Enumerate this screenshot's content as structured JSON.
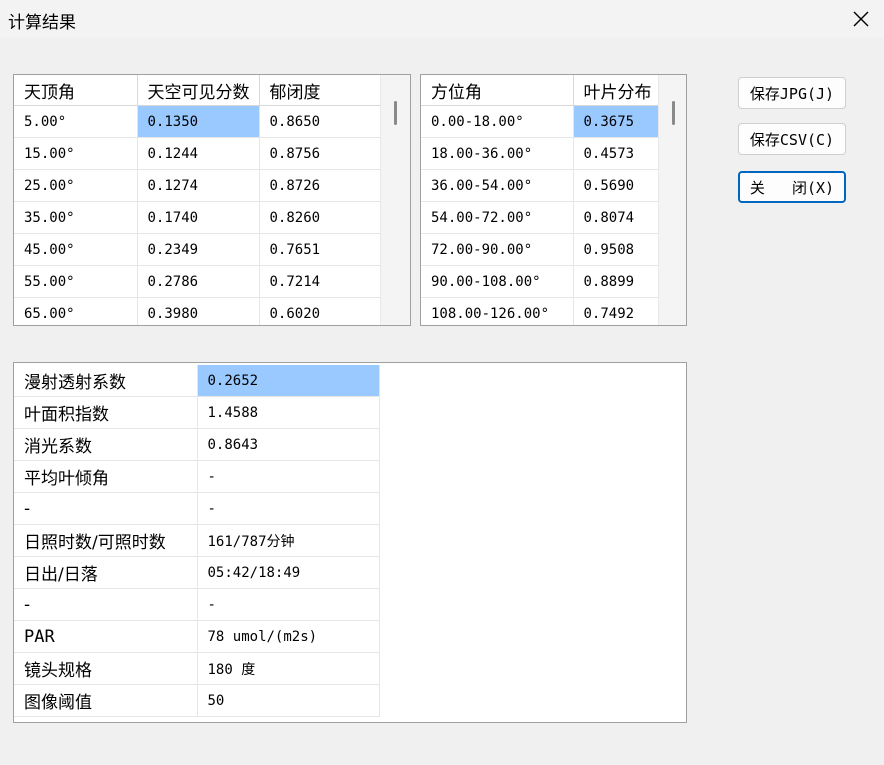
{
  "window": {
    "title": "计算结果"
  },
  "zenith_table": {
    "headers": [
      "天顶角",
      "天空可见分数",
      "郁闭度"
    ],
    "rows": [
      [
        "5.00°",
        "0.1350",
        "0.8650"
      ],
      [
        "15.00°",
        "0.1244",
        "0.8756"
      ],
      [
        "25.00°",
        "0.1274",
        "0.8726"
      ],
      [
        "35.00°",
        "0.1740",
        "0.8260"
      ],
      [
        "45.00°",
        "0.2349",
        "0.7651"
      ],
      [
        "55.00°",
        "0.2786",
        "0.7214"
      ],
      [
        "65.00°",
        "0.3980",
        "0.6020"
      ]
    ]
  },
  "azimuth_table": {
    "headers": [
      "方位角",
      "叶片分布"
    ],
    "rows": [
      [
        "0.00-18.00°",
        "0.3675"
      ],
      [
        "18.00-36.00°",
        "0.4573"
      ],
      [
        "36.00-54.00°",
        "0.5690"
      ],
      [
        "54.00-72.00°",
        "0.8074"
      ],
      [
        "72.00-90.00°",
        "0.9508"
      ],
      [
        "90.00-108.00°",
        "0.8899"
      ],
      [
        "108.00-126.00°",
        "0.7492"
      ]
    ]
  },
  "buttons": {
    "save_jpg": "保存JPG(J)",
    "save_csv": "保存CSV(C)",
    "close": "关   闭(X)"
  },
  "results": [
    [
      "漫射透射系数",
      "0.2652"
    ],
    [
      "叶面积指数",
      "1.4588"
    ],
    [
      "消光系数",
      "0.8643"
    ],
    [
      "平均叶倾角",
      "-"
    ],
    [
      "-",
      "-"
    ],
    [
      "日照时数/可照时数",
      "161/787分钟"
    ],
    [
      "日出/日落",
      "05:42/18:49"
    ],
    [
      "-",
      "-"
    ],
    [
      "PAR",
      "78 umol/(m2s)"
    ],
    [
      "镜头规格",
      "180 度"
    ],
    [
      "图像阈值",
      "50"
    ]
  ]
}
